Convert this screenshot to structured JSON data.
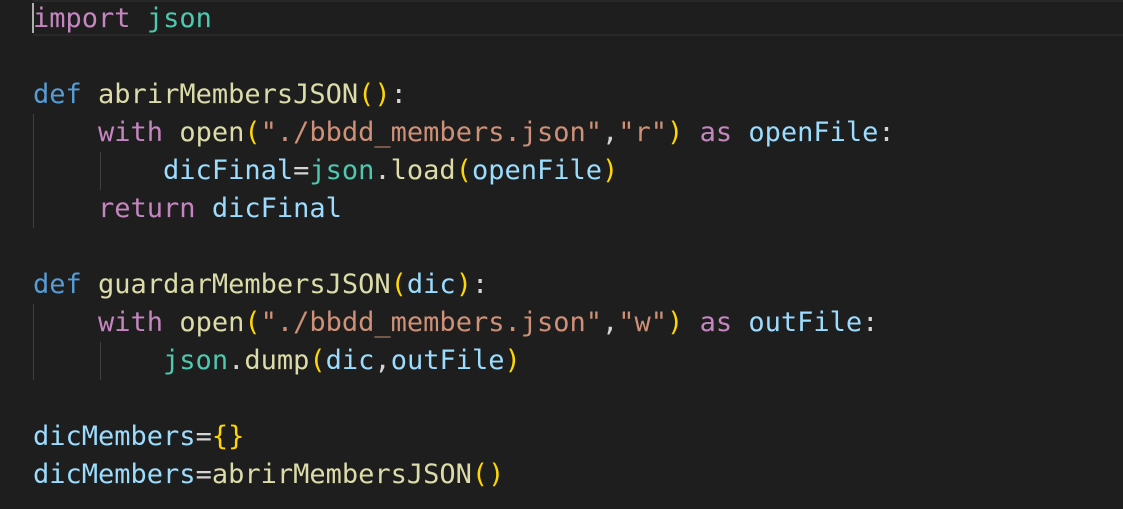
{
  "editor": {
    "language": "python",
    "theme_colors": {
      "background": "#1e1e1e",
      "keyword_def": "#569cd6",
      "keyword_control": "#c586c0",
      "module": "#4ec9b0",
      "function": "#dcdcaa",
      "variable": "#9cdcfe",
      "string": "#ce9178",
      "bracket_level1": "#ffd700",
      "bracket_level2": "#da70d6",
      "default_text": "#d4d4d4"
    },
    "lines": [
      [
        {
          "t": "ctl",
          "v": "import"
        },
        {
          "t": "op",
          "v": " "
        },
        {
          "t": "mod",
          "v": "json"
        }
      ],
      [],
      [
        {
          "t": "kw",
          "v": "def"
        },
        {
          "t": "op",
          "v": " "
        },
        {
          "t": "fn",
          "v": "abrirMembersJSON"
        },
        {
          "t": "br1",
          "v": "()"
        },
        {
          "t": "op",
          "v": ":"
        }
      ],
      [
        {
          "t": "op",
          "v": "    "
        },
        {
          "t": "ctl",
          "v": "with"
        },
        {
          "t": "op",
          "v": " "
        },
        {
          "t": "fn",
          "v": "open"
        },
        {
          "t": "br1",
          "v": "("
        },
        {
          "t": "str",
          "v": "\"./bbdd_members.json\""
        },
        {
          "t": "op",
          "v": ","
        },
        {
          "t": "str",
          "v": "\"r\""
        },
        {
          "t": "br1",
          "v": ")"
        },
        {
          "t": "op",
          "v": " "
        },
        {
          "t": "ctl",
          "v": "as"
        },
        {
          "t": "op",
          "v": " "
        },
        {
          "t": "var",
          "v": "openFile"
        },
        {
          "t": "op",
          "v": ":"
        }
      ],
      [
        {
          "t": "op",
          "v": "        "
        },
        {
          "t": "var",
          "v": "dicFinal"
        },
        {
          "t": "op",
          "v": "="
        },
        {
          "t": "mod",
          "v": "json"
        },
        {
          "t": "op",
          "v": "."
        },
        {
          "t": "fn",
          "v": "load"
        },
        {
          "t": "br1",
          "v": "("
        },
        {
          "t": "var",
          "v": "openFile"
        },
        {
          "t": "br1",
          "v": ")"
        }
      ],
      [
        {
          "t": "op",
          "v": "    "
        },
        {
          "t": "ctl",
          "v": "return"
        },
        {
          "t": "op",
          "v": " "
        },
        {
          "t": "var",
          "v": "dicFinal"
        }
      ],
      [],
      [
        {
          "t": "kw",
          "v": "def"
        },
        {
          "t": "op",
          "v": " "
        },
        {
          "t": "fn",
          "v": "guardarMembersJSON"
        },
        {
          "t": "br1",
          "v": "("
        },
        {
          "t": "var",
          "v": "dic"
        },
        {
          "t": "br1",
          "v": ")"
        },
        {
          "t": "op",
          "v": ":"
        }
      ],
      [
        {
          "t": "op",
          "v": "    "
        },
        {
          "t": "ctl",
          "v": "with"
        },
        {
          "t": "op",
          "v": " "
        },
        {
          "t": "fn",
          "v": "open"
        },
        {
          "t": "br1",
          "v": "("
        },
        {
          "t": "str",
          "v": "\"./bbdd_members.json\""
        },
        {
          "t": "op",
          "v": ","
        },
        {
          "t": "str",
          "v": "\"w\""
        },
        {
          "t": "br1",
          "v": ")"
        },
        {
          "t": "op",
          "v": " "
        },
        {
          "t": "ctl",
          "v": "as"
        },
        {
          "t": "op",
          "v": " "
        },
        {
          "t": "var",
          "v": "outFile"
        },
        {
          "t": "op",
          "v": ":"
        }
      ],
      [
        {
          "t": "op",
          "v": "        "
        },
        {
          "t": "mod",
          "v": "json"
        },
        {
          "t": "op",
          "v": "."
        },
        {
          "t": "fn",
          "v": "dump"
        },
        {
          "t": "br1",
          "v": "("
        },
        {
          "t": "var",
          "v": "dic"
        },
        {
          "t": "op",
          "v": ","
        },
        {
          "t": "var",
          "v": "outFile"
        },
        {
          "t": "br1",
          "v": ")"
        }
      ],
      [],
      [
        {
          "t": "var",
          "v": "dicMembers"
        },
        {
          "t": "op",
          "v": "="
        },
        {
          "t": "br1",
          "v": "{}"
        }
      ],
      [
        {
          "t": "var",
          "v": "dicMembers"
        },
        {
          "t": "op",
          "v": "="
        },
        {
          "t": "fn",
          "v": "abrirMembersJSON"
        },
        {
          "t": "br1",
          "v": "()"
        }
      ]
    ]
  }
}
